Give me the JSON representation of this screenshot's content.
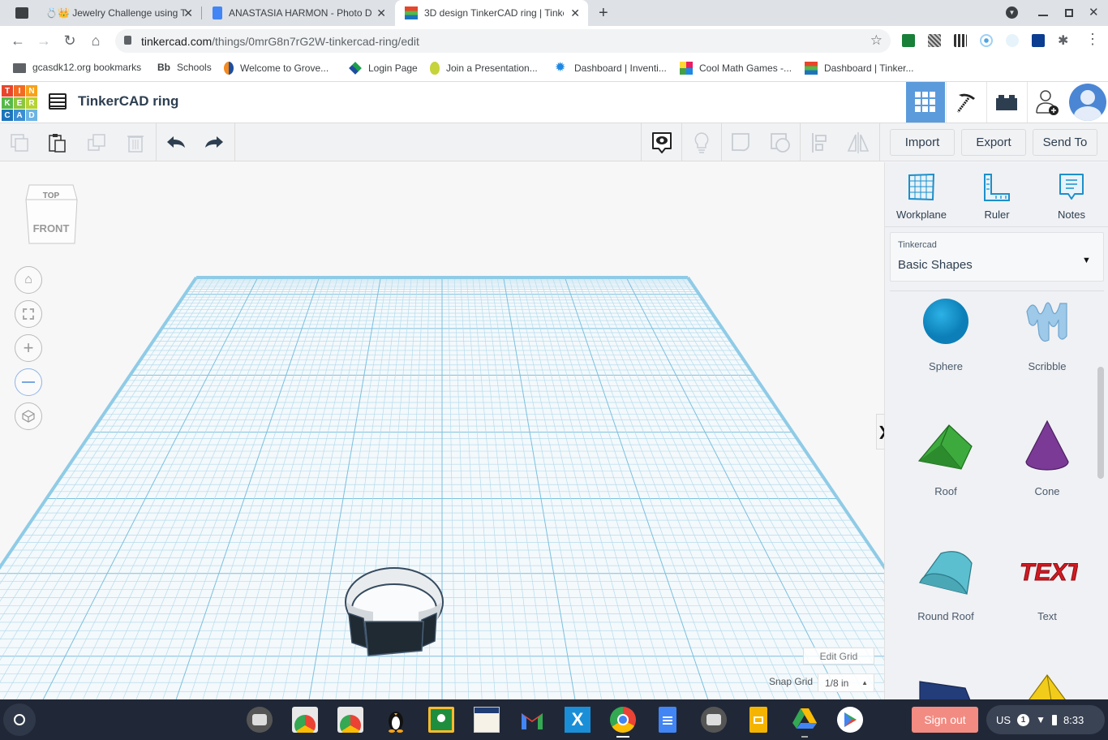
{
  "browser": {
    "tabs": [
      {
        "title": "💍👑 Jewelry Challenge using T",
        "icon": "classroom-assignment-icon",
        "active": false
      },
      {
        "title": "ANASTASIA HARMON - Photo Dc",
        "icon": "google-docs-icon",
        "active": false
      },
      {
        "title": "3D design TinkerCAD ring | Tinke",
        "icon": "tinkercad-icon",
        "active": true
      }
    ],
    "new_tab_label": "+",
    "url_host": "tinkercad.com",
    "url_path": "/things/0mrG8n7rG2W-tinkercad-ring/edit",
    "bookmarks": [
      {
        "label": "gcasdk12.org bookmarks",
        "icon": "folder-icon"
      },
      {
        "label": "Schools",
        "icon": "blackboard-icon",
        "prefix": "Bb"
      },
      {
        "label": "Welcome to Grove...",
        "icon": "grove-icon"
      },
      {
        "label": "Login Page",
        "icon": "login-icon"
      },
      {
        "label": "Join a Presentation...",
        "icon": "peardeck-icon"
      },
      {
        "label": "Dashboard | Inventi...",
        "icon": "gear-icon"
      },
      {
        "label": "Cool Math Games -...",
        "icon": "coolmath-icon"
      },
      {
        "label": "Dashboard | Tinker...",
        "icon": "tinkercad-icon"
      }
    ]
  },
  "app": {
    "logo_letters": [
      "T",
      "I",
      "N",
      "K",
      "E",
      "R",
      "C",
      "A",
      "D"
    ],
    "logo_colors": [
      "#e8452c",
      "#f26b20",
      "#f7a21a",
      "#55b948",
      "#8cc63f",
      "#b6d334",
      "#1c75bc",
      "#3a8ed3",
      "#6cb4e4"
    ],
    "design_title": "TinkerCAD ring",
    "toolbar": {
      "import_label": "Import",
      "export_label": "Export",
      "send_to_label": "Send To"
    },
    "viewcube": {
      "top_label": "TOP",
      "front_label": "FRONT"
    },
    "grid": {
      "edit_grid_label": "Edit Grid",
      "snap_grid_label": "Snap Grid",
      "snap_grid_value": "1/8 in"
    },
    "panel": {
      "tools": [
        {
          "label": "Workplane",
          "icon": "workplane-icon"
        },
        {
          "label": "Ruler",
          "icon": "ruler-icon"
        },
        {
          "label": "Notes",
          "icon": "notes-icon"
        }
      ],
      "library_source": "Tinkercad",
      "library_name": "Basic Shapes",
      "shapes": [
        {
          "label": "Sphere",
          "color": "#1a9ad6"
        },
        {
          "label": "Scribble",
          "color": "#9ec9e8"
        },
        {
          "label": "Roof",
          "color": "#3daa3d"
        },
        {
          "label": "Cone",
          "color": "#7b3a96"
        },
        {
          "label": "Round Roof",
          "color": "#5bbfcf"
        },
        {
          "label": "Text",
          "color": "#d11a22"
        },
        {
          "label": "",
          "color": "#233d7a"
        },
        {
          "label": "",
          "color": "#f2cc1a"
        }
      ],
      "collapse_label": "❯"
    },
    "accent": "#5b9bdc"
  },
  "os": {
    "sign_out_label": "Sign out",
    "keyboard_layout": "US",
    "notification_count": "1",
    "time": "8:33",
    "shelf_apps": [
      "camera",
      "chrome-app-1",
      "chrome-app-2",
      "linux-penguin",
      "google-classroom",
      "pearson-testnav",
      "gmail",
      "explain-everything",
      "google-chrome",
      "google-docs",
      "camera-2",
      "google-slides",
      "google-drive",
      "google-play"
    ]
  }
}
